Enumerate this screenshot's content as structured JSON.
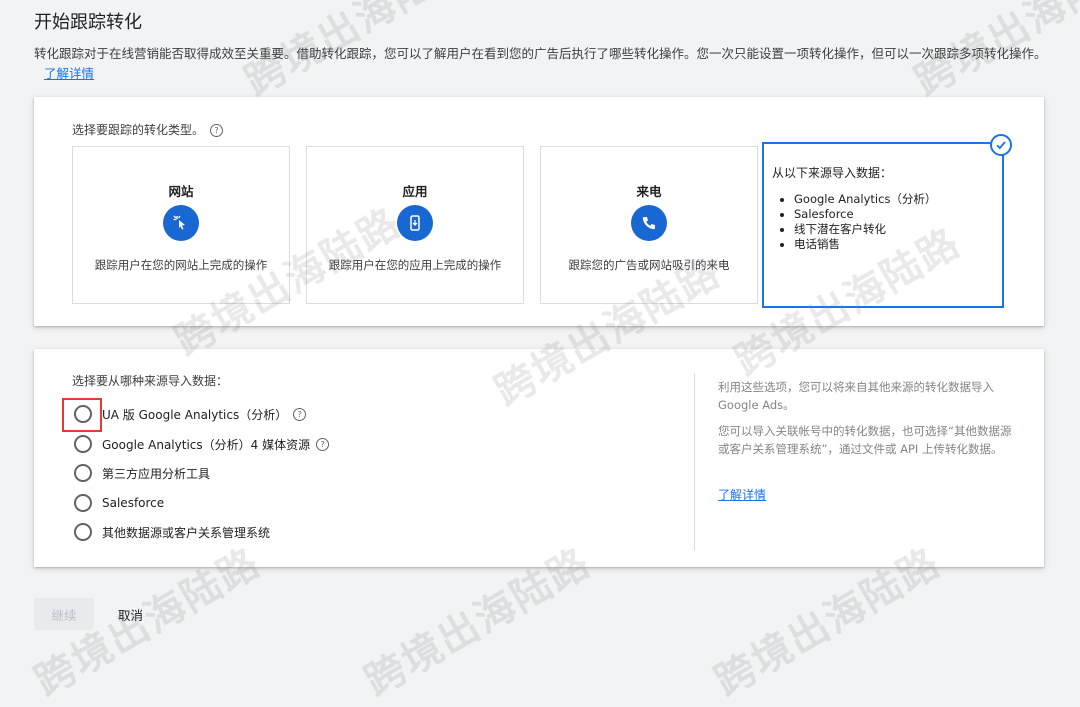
{
  "header": {
    "title": "开始跟踪转化",
    "intro": "转化跟踪对于在线营销能否取得成效至关重要。借助转化跟踪，您可以了解用户在看到您的广告后执行了哪些转化操作。您一次只能设置一项转化操作，但可以一次跟踪多项转化操作。",
    "learn_more": "了解详情"
  },
  "conversion_types": {
    "label": "选择要跟踪的转化类型。",
    "items": [
      {
        "name": "网站",
        "desc": "跟踪用户在您的网站上完成的操作",
        "icon": "cursor-click-icon"
      },
      {
        "name": "应用",
        "desc": "跟踪用户在您的应用上完成的操作",
        "icon": "mobile-app-icon"
      },
      {
        "name": "来电",
        "desc": "跟踪您的广告或网站吸引的来电",
        "icon": "phone-icon"
      }
    ],
    "import": {
      "title": "从以下来源导入数据：",
      "sources": [
        "Google Analytics（分析）",
        "Salesforce",
        "线下潜在客户转化",
        "电话销售"
      ],
      "selected": true
    }
  },
  "import_source": {
    "label": "选择要从哪种来源导入数据：",
    "options": [
      "UA 版 Google Analytics（分析）",
      "Google Analytics（分析）4 媒体资源",
      "第三方应用分析工具",
      "Salesforce",
      "其他数据源或客户关系管理系统"
    ],
    "side_text_1": "利用这些选项，您可以将来自其他来源的转化数据导入 Google Ads。",
    "side_text_2": "您可以导入关联帐号中的转化数据，也可选择“其他数据源或客户关系管理系统”，通过文件或 API 上传转化数据。",
    "side_link": "了解详情"
  },
  "footer": {
    "continue_label": "继续",
    "cancel_label": "取消"
  },
  "watermark": "跨境出海陆路",
  "colors": {
    "accent": "#1a73e8",
    "icon_bg": "#1967d2",
    "highlight": "#e53935"
  }
}
